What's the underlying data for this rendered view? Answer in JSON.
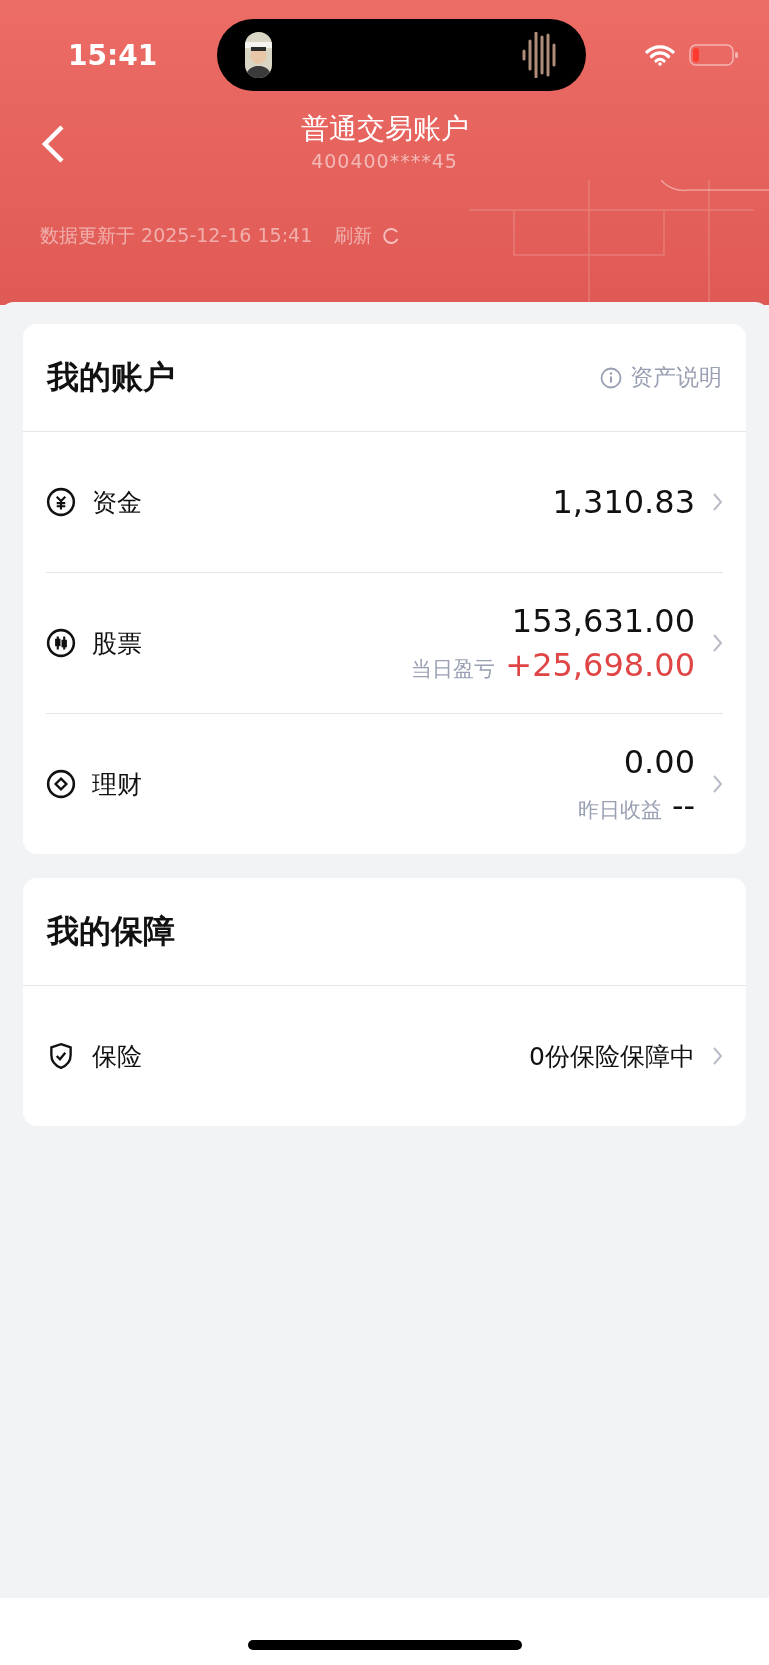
{
  "status_bar": {
    "time": "15:41"
  },
  "nav": {
    "title": "普通交易账户",
    "account": "400400****45"
  },
  "update": {
    "text": "数据更新于 2025-12-16 15:41",
    "refresh": "刷新"
  },
  "account_card": {
    "title": "我的账户",
    "help": "资产说明",
    "rows": [
      {
        "kind": "cash",
        "label": "资金",
        "value": "1,310.83"
      },
      {
        "kind": "stock",
        "label": "股票",
        "value": "153,631.00",
        "sub_label": "当日盈亏",
        "sub_value": "+25,698.00",
        "color": "#e04545"
      },
      {
        "kind": "wealth",
        "label": "理财",
        "value": "0.00",
        "sub_label": "昨日收益",
        "sub_value": "--",
        "color": "#111111"
      }
    ]
  },
  "protection_card": {
    "title": "我的保障",
    "rows": [
      {
        "kind": "insurance",
        "label": "保险",
        "value": "0份保险保障中"
      }
    ]
  }
}
